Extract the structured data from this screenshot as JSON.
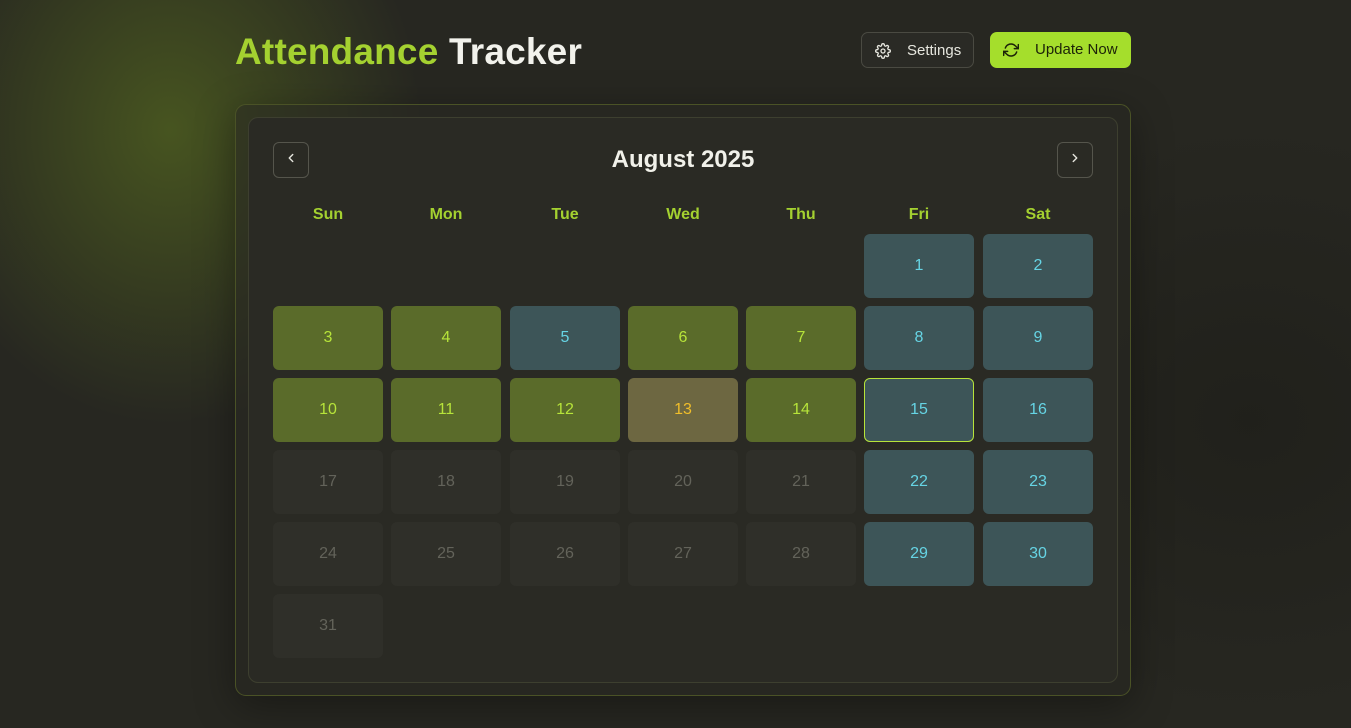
{
  "header": {
    "title_accent": "Attendance",
    "title_main": "Tracker",
    "settings_label": "Settings",
    "update_label": "Update Now",
    "settings_icon": "gear-icon",
    "update_icon": "refresh-icon"
  },
  "calendar": {
    "month_label": "August 2025",
    "prev_icon": "chevron-left-icon",
    "next_icon": "chevron-right-icon",
    "weekdays": [
      "Sun",
      "Mon",
      "Tue",
      "Wed",
      "Thu",
      "Fri",
      "Sat"
    ],
    "first_weekday_index": 5,
    "days": [
      {
        "day": "1",
        "status": "weekend"
      },
      {
        "day": "2",
        "status": "weekend"
      },
      {
        "day": "3",
        "status": "present"
      },
      {
        "day": "4",
        "status": "present"
      },
      {
        "day": "5",
        "status": "weekend"
      },
      {
        "day": "6",
        "status": "present"
      },
      {
        "day": "7",
        "status": "present"
      },
      {
        "day": "8",
        "status": "weekend"
      },
      {
        "day": "9",
        "status": "weekend"
      },
      {
        "day": "10",
        "status": "present"
      },
      {
        "day": "11",
        "status": "present"
      },
      {
        "day": "12",
        "status": "present"
      },
      {
        "day": "13",
        "status": "holiday"
      },
      {
        "day": "14",
        "status": "present"
      },
      {
        "day": "15",
        "status": "weekend",
        "today": true
      },
      {
        "day": "16",
        "status": "weekend"
      },
      {
        "day": "17",
        "status": "future"
      },
      {
        "day": "18",
        "status": "future"
      },
      {
        "day": "19",
        "status": "future"
      },
      {
        "day": "20",
        "status": "future"
      },
      {
        "day": "21",
        "status": "future"
      },
      {
        "day": "22",
        "status": "weekend"
      },
      {
        "day": "23",
        "status": "weekend"
      },
      {
        "day": "24",
        "status": "future"
      },
      {
        "day": "25",
        "status": "future"
      },
      {
        "day": "26",
        "status": "future"
      },
      {
        "day": "27",
        "status": "future"
      },
      {
        "day": "28",
        "status": "future"
      },
      {
        "day": "29",
        "status": "weekend"
      },
      {
        "day": "30",
        "status": "weekend"
      },
      {
        "day": "31",
        "status": "future"
      }
    ]
  },
  "colors": {
    "accent": "#a4d130",
    "present_bg": "#5a6b2a",
    "weekend_bg": "#3d5558",
    "holiday_bg": "#6d6741",
    "future_bg": "#2f2f29"
  }
}
